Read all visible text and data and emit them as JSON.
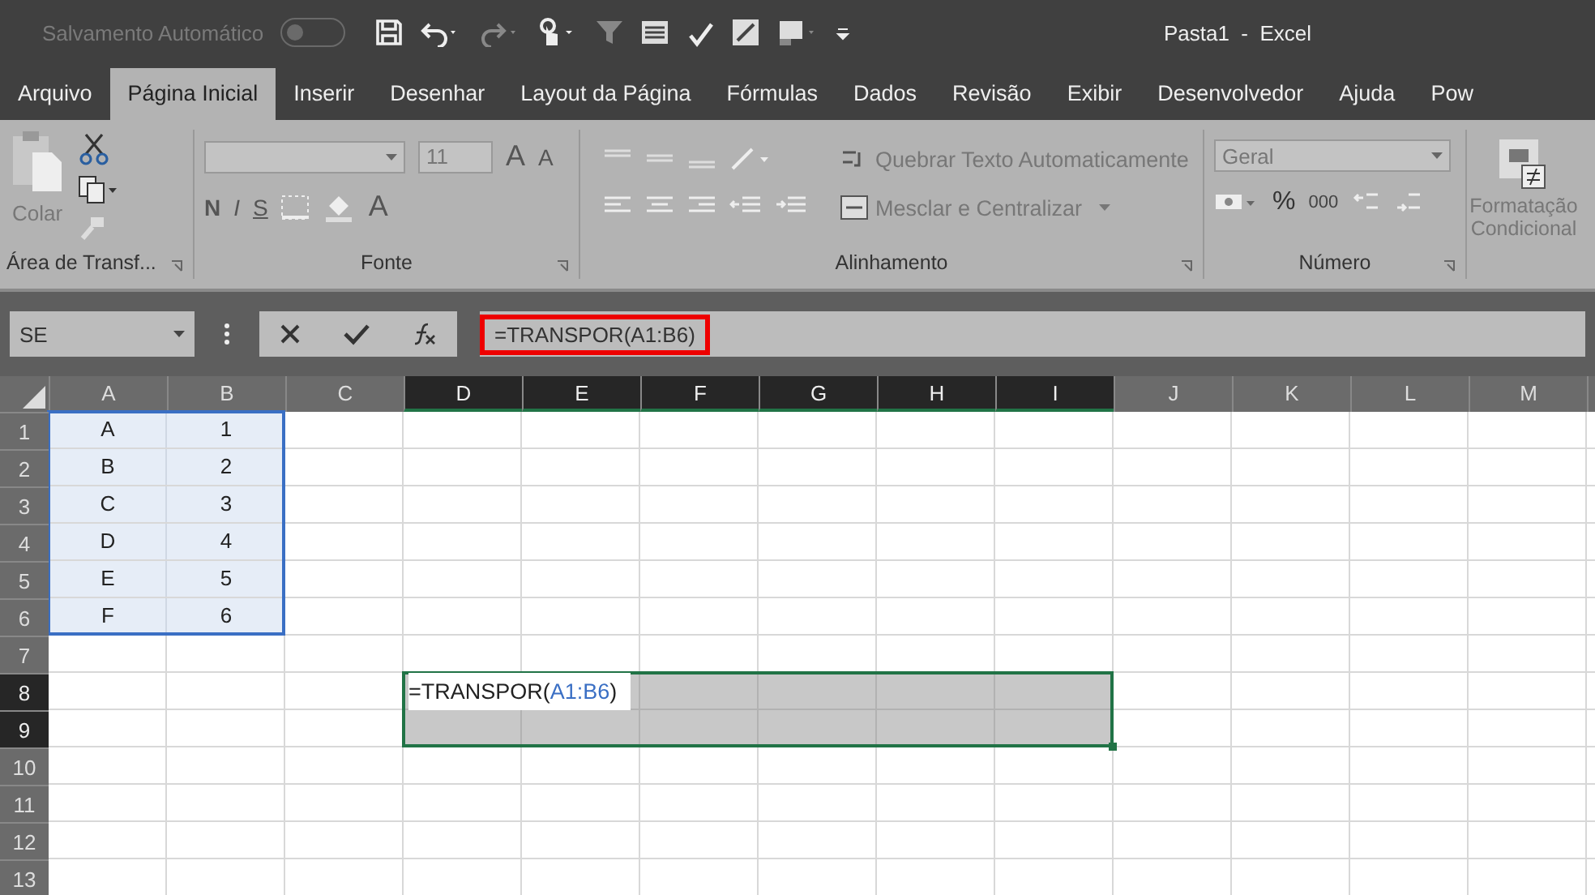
{
  "title_bar": {
    "autosave_label": "Salvamento Automático",
    "autosave_on": false,
    "title": "Pasta1  -  Excel"
  },
  "tabs": [
    {
      "label": "Arquivo",
      "selected": false
    },
    {
      "label": "Página Inicial",
      "selected": true
    },
    {
      "label": "Inserir",
      "selected": false
    },
    {
      "label": "Desenhar",
      "selected": false
    },
    {
      "label": "Layout da Página",
      "selected": false
    },
    {
      "label": "Fórmulas",
      "selected": false
    },
    {
      "label": "Dados",
      "selected": false
    },
    {
      "label": "Revisão",
      "selected": false
    },
    {
      "label": "Exibir",
      "selected": false
    },
    {
      "label": "Desenvolvedor",
      "selected": false
    },
    {
      "label": "Ajuda",
      "selected": false
    },
    {
      "label": "Pow",
      "selected": false
    }
  ],
  "ribbon": {
    "clipboard": {
      "paste_label": "Colar",
      "group_label": "Área de Transf..."
    },
    "font": {
      "size": "11",
      "bold": "N",
      "italic": "I",
      "underline": "S",
      "grow": "A",
      "shrink": "A",
      "text_color_label": "A",
      "group_label": "Fonte"
    },
    "alignment": {
      "wrap_label": "Quebrar Texto Automaticamente",
      "merge_label": "Mesclar e Centralizar",
      "group_label": "Alinhamento"
    },
    "number": {
      "format": "Geral",
      "percent": "%",
      "thousands": "000",
      "group_label": "Número"
    },
    "styles": {
      "conditional_label": "Formatação Condicional"
    }
  },
  "formula_bar": {
    "name_box": "SE",
    "formula": "=TRANSPOR(A1:B6)",
    "highlighted": true
  },
  "sheet": {
    "columns": [
      {
        "label": "A",
        "selected": false
      },
      {
        "label": "B",
        "selected": false
      },
      {
        "label": "C",
        "selected": false
      },
      {
        "label": "D",
        "selected": true
      },
      {
        "label": "E",
        "selected": true
      },
      {
        "label": "F",
        "selected": true
      },
      {
        "label": "G",
        "selected": true
      },
      {
        "label": "H",
        "selected": true
      },
      {
        "label": "I",
        "selected": true
      },
      {
        "label": "J",
        "selected": false
      },
      {
        "label": "K",
        "selected": false
      },
      {
        "label": "L",
        "selected": false
      },
      {
        "label": "M",
        "selected": false
      }
    ],
    "rows": [
      {
        "label": "1",
        "selected": false,
        "highlighted": true,
        "values": [
          "A",
          "1"
        ]
      },
      {
        "label": "2",
        "selected": false,
        "highlighted": true,
        "values": [
          "B",
          "2"
        ]
      },
      {
        "label": "3",
        "selected": false,
        "highlighted": true,
        "values": [
          "C",
          "3"
        ]
      },
      {
        "label": "4",
        "selected": false,
        "highlighted": true,
        "values": [
          "D",
          "4"
        ]
      },
      {
        "label": "5",
        "selected": false,
        "highlighted": true,
        "values": [
          "E",
          "5"
        ]
      },
      {
        "label": "6",
        "selected": false,
        "highlighted": true,
        "values": [
          "F",
          "6"
        ]
      },
      {
        "label": "7",
        "selected": false,
        "highlighted": false,
        "values": []
      },
      {
        "label": "8",
        "selected": true,
        "highlighted": false,
        "values": []
      },
      {
        "label": "9",
        "selected": true,
        "highlighted": false,
        "values": []
      },
      {
        "label": "10",
        "selected": false,
        "highlighted": false,
        "values": []
      },
      {
        "label": "11",
        "selected": false,
        "highlighted": false,
        "values": []
      },
      {
        "label": "12",
        "selected": false,
        "highlighted": false,
        "values": []
      },
      {
        "label": "13",
        "selected": false,
        "highlighted": false,
        "values": []
      }
    ],
    "editing_cell": {
      "prefix": "=TRANSPOR(",
      "reference": "A1:B6",
      "suffix": ")"
    }
  }
}
